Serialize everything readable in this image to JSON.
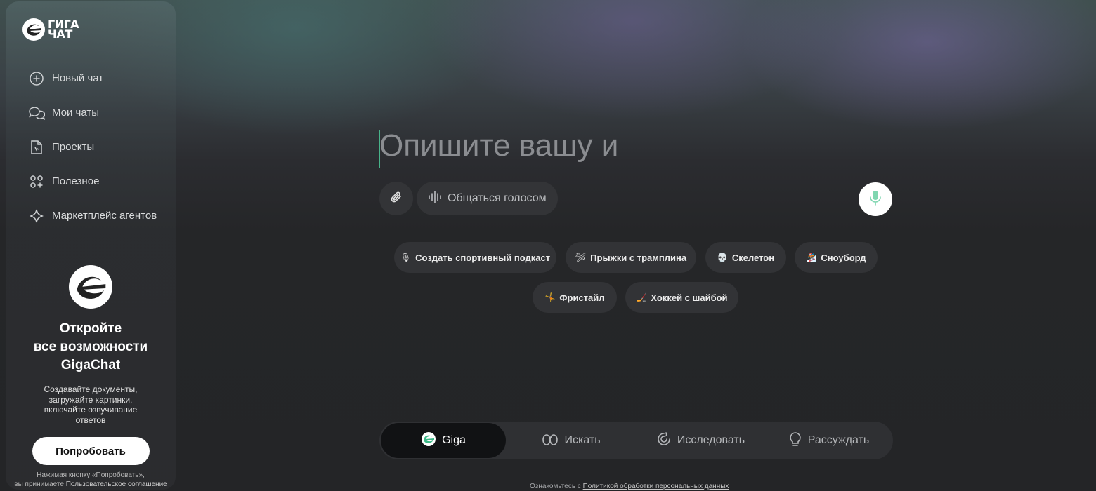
{
  "logo": {
    "line1": "ГИГА",
    "line2": "ЧАТ"
  },
  "sidebar": {
    "items": [
      {
        "label": "Новый чат",
        "icon": "plus-circle-icon"
      },
      {
        "label": "Мои чаты",
        "icon": "chat-bubbles-icon"
      },
      {
        "label": "Проекты",
        "icon": "project-file-icon"
      },
      {
        "label": "Полезное",
        "icon": "apps-icon"
      },
      {
        "label": "Маркетплейс агентов",
        "icon": "sparkle-icon"
      }
    ],
    "promo": {
      "title_line1": "Откройте",
      "title_line2": "все возможности",
      "title_line3": "GigaChat",
      "text": "Создавайте документы, загружайте картинки, включайте озвучивание ответов",
      "button": "Попробовать",
      "foot_line1": "Нажимая кнопку «Попробовать»,",
      "foot_line2_prefix": "вы принимаете ",
      "foot_link": "Пользовательское соглашение"
    }
  },
  "composer": {
    "prompt": "Опишите вашу и",
    "voice_label": "Общаться голосом"
  },
  "suggestions": [
    {
      "emoji": "🎙",
      "label": "Создать спортивный подкаст"
    },
    {
      "emoji": "🛩",
      "label": "Прыжки с трамплина"
    },
    {
      "emoji": "💀",
      "label": "Скелетон"
    },
    {
      "emoji": "🏂",
      "label": "Сноуборд"
    },
    {
      "emoji": "🤸",
      "label": "Фристайл"
    },
    {
      "emoji": "🏒",
      "label": "Хоккей с шайбой"
    }
  ],
  "modes": [
    {
      "label": "Giga",
      "active": true
    },
    {
      "label": "Искать",
      "active": false
    },
    {
      "label": "Исследовать",
      "active": false
    },
    {
      "label": "Рассуждать",
      "active": false
    }
  ],
  "footer": {
    "prefix": "Ознакомьтесь с ",
    "link": "Политикой обработки персональных данных"
  },
  "colors": {
    "accent": "#48b38a",
    "background": "#242527",
    "chip": "#323336"
  }
}
